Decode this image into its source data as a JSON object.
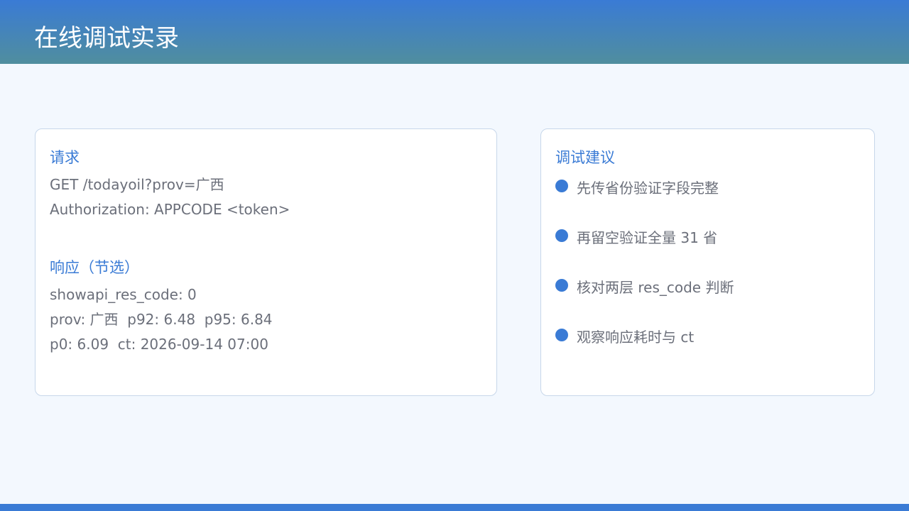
{
  "header": {
    "title": "在线调试实录"
  },
  "request": {
    "heading": "请求",
    "lines": [
      "GET /todayoil?prov=广西",
      "Authorization: APPCODE <token>"
    ]
  },
  "response": {
    "heading": "响应（节选）",
    "lines": [
      "showapi_res_code: 0",
      "prov: 广西  p92: 6.48  p95: 6.84",
      "p0: 6.09  ct: 2026-09-14 07:00"
    ]
  },
  "tips": {
    "heading": "调试建议",
    "items": [
      "先传省份验证字段完整",
      "再留空验证全量 31 省",
      "核对两层 res_code 判断",
      "观察响应耗时与 ct"
    ]
  },
  "colors": {
    "accent": "#3a7bd5",
    "header_gradient_end": "#508e9e",
    "background": "#f3f8fe",
    "card_border": "#c7d7ea",
    "body_text": "#6b6f7a"
  }
}
